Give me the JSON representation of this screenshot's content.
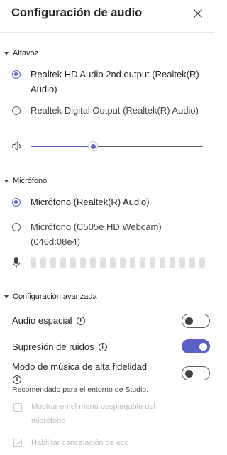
{
  "panel": {
    "title": "Configuración de audio"
  },
  "speaker": {
    "section_label": "Altavoz",
    "options": [
      {
        "label": "Realtek HD Audio 2nd output (Realtek(R) Audio)",
        "selected": true
      },
      {
        "label": "Realtek Digital Output (Realtek(R) Audio)",
        "selected": false
      }
    ],
    "volume_level": 0.36
  },
  "microphone": {
    "section_label": "Micrófono",
    "options": [
      {
        "label": "Micrófono (Realtek(R) Audio)",
        "selected": true
      },
      {
        "label": "Micrófono (C505e HD Webcam) (046d:08e4)",
        "selected": false
      }
    ],
    "meter_level": 0
  },
  "advanced": {
    "section_label": "Configuración avanzada",
    "spatial_audio": {
      "label": "Audio espacial",
      "on": false
    },
    "noise_suppression": {
      "label": "Supresión de ruidos",
      "on": true
    },
    "hifi_music": {
      "label": "Modo de música de alta fidelidad",
      "on": false
    },
    "hifi_note": "Recomendado para el entorno de Studio.",
    "show_in_dropdown": {
      "label": "Mostrar en el menú desplegable del micrófono",
      "checked": false,
      "disabled": true
    },
    "echo_cancel": {
      "label": "Habilitar cancelación de eco",
      "checked": true,
      "disabled": true
    }
  },
  "colors": {
    "accent": "#5b5fc7",
    "text": "#242424",
    "disabled": "#bdbdbd"
  }
}
